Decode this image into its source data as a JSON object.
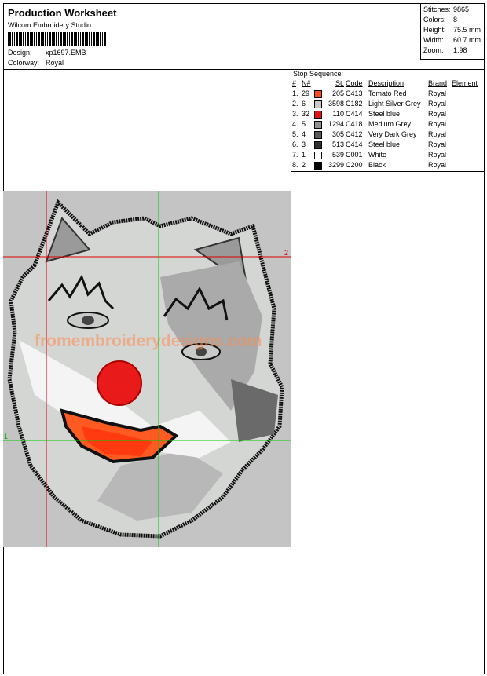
{
  "header": {
    "title": "Production Worksheet",
    "software": "Wilcom Embroidery Studio",
    "design_label": "Design:",
    "design_value": "xp1697.EMB",
    "colorway_label": "Colorway:",
    "colorway_value": "Royal"
  },
  "stats": [
    {
      "label": "Stitches:",
      "value": "9865"
    },
    {
      "label": "Colors:",
      "value": "8"
    },
    {
      "label": "Height:",
      "value": "75.5 mm"
    },
    {
      "label": "Width:",
      "value": "60.7 mm"
    },
    {
      "label": "Zoom:",
      "value": "1.98"
    }
  ],
  "stop_sequence": {
    "title": "Stop Sequence:",
    "headers": [
      "#",
      "N#",
      "St.",
      "Code",
      "Description",
      "Brand",
      "Element"
    ],
    "rows": [
      {
        "idx": "1.",
        "n": "29",
        "swatch": "#ff4a1a",
        "st": "205",
        "code": "C413",
        "desc": "Tomato Red",
        "brand": "Royal"
      },
      {
        "idx": "2.",
        "n": "6",
        "swatch": "#c8cac8",
        "st": "3598",
        "code": "C182",
        "desc": "Light Silver Grey",
        "brand": "Royal"
      },
      {
        "idx": "3.",
        "n": "32",
        "swatch": "#e81010",
        "st": "110",
        "code": "C414",
        "desc": "Steel blue",
        "brand": "Royal"
      },
      {
        "idx": "4.",
        "n": "5",
        "swatch": "#909090",
        "st": "1294",
        "code": "C418",
        "desc": "Medium Grey",
        "brand": "Royal"
      },
      {
        "idx": "5.",
        "n": "4",
        "swatch": "#5a5a5a",
        "st": "305",
        "code": "C412",
        "desc": "Very Dark Grey",
        "brand": "Royal"
      },
      {
        "idx": "6.",
        "n": "3",
        "swatch": "#303030",
        "st": "513",
        "code": "C414",
        "desc": "Steel blue",
        "brand": "Royal"
      },
      {
        "idx": "7.",
        "n": "1",
        "swatch": "#ffffff",
        "st": "539",
        "code": "C001",
        "desc": "White",
        "brand": "Royal"
      },
      {
        "idx": "8.",
        "n": "2",
        "swatch": "#000000",
        "st": "3299",
        "code": "C200",
        "desc": "Black",
        "brand": "Royal"
      }
    ]
  },
  "preview": {
    "background": "#c4c4c4",
    "marker_red_label": "2",
    "marker_green_label": "1",
    "watermark": "fromembroiderydesigns.com"
  }
}
